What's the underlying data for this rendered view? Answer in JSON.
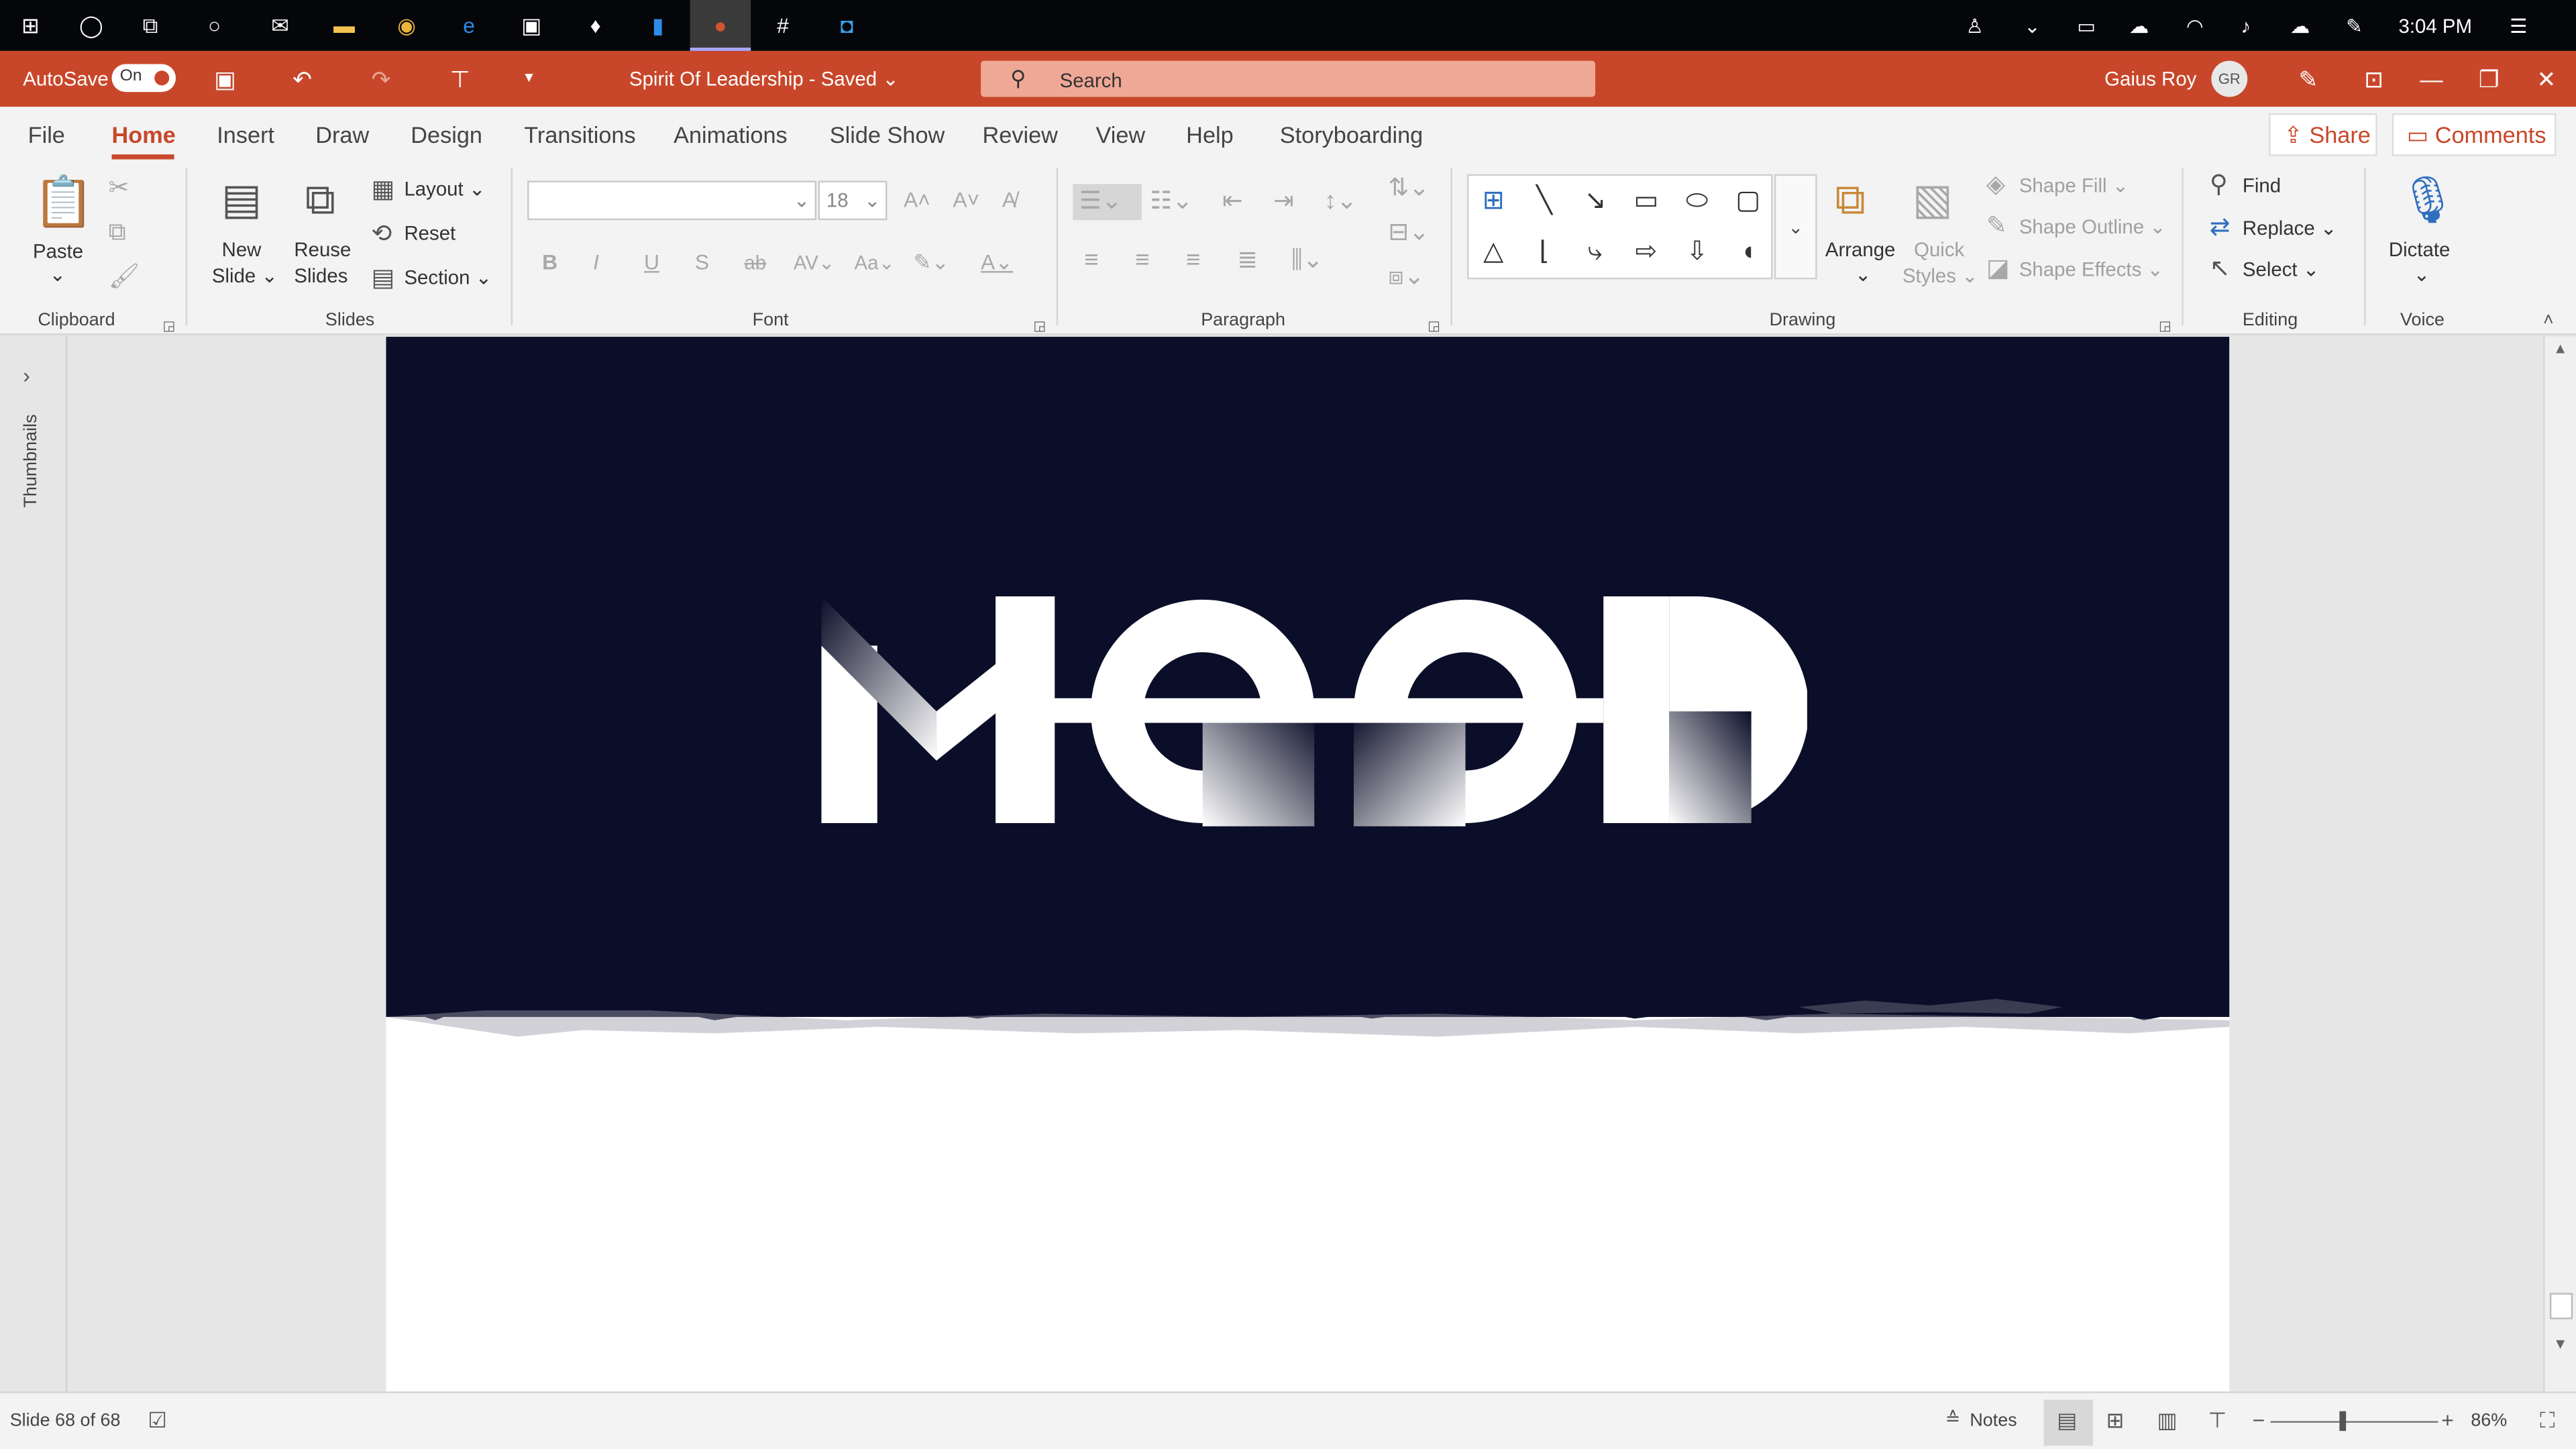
{
  "taskbar": {
    "apps": [
      {
        "icon": "windows-start-icon",
        "glyph": "⊞"
      },
      {
        "icon": "cortana-icon",
        "glyph": "◯"
      },
      {
        "icon": "task-view-icon",
        "glyph": "⧉"
      },
      {
        "icon": "app-circle-icon",
        "glyph": "○"
      },
      {
        "icon": "mail-icon",
        "glyph": "✉"
      },
      {
        "icon": "file-explorer-icon",
        "glyph": "▬"
      },
      {
        "icon": "chrome-icon",
        "glyph": "◉"
      },
      {
        "icon": "edge-icon",
        "glyph": "e"
      },
      {
        "icon": "store-icon",
        "glyph": "▣"
      },
      {
        "icon": "lightbulb-icon",
        "glyph": "♦"
      },
      {
        "icon": "phone-icon",
        "glyph": "▮"
      },
      {
        "icon": "powerpoint-icon",
        "glyph": "●"
      },
      {
        "icon": "slack-icon",
        "glyph": "#"
      },
      {
        "icon": "app-square-icon",
        "glyph": "◘"
      }
    ],
    "tray": [
      {
        "icon": "people-icon",
        "glyph": "♙"
      },
      {
        "icon": "chevron-up-icon",
        "glyph": "⌄"
      },
      {
        "icon": "battery-icon",
        "glyph": "▭"
      },
      {
        "icon": "onedrive-icon",
        "glyph": "☁"
      },
      {
        "icon": "wifi-icon",
        "glyph": "◠"
      },
      {
        "icon": "volume-icon",
        "glyph": "♪"
      },
      {
        "icon": "upload-icon",
        "glyph": "☁"
      },
      {
        "icon": "pen-icon",
        "glyph": "✎"
      }
    ],
    "clock": "3:04 PM",
    "notification_icon": "notification-icon",
    "notification_glyph": "☰"
  },
  "titlebar": {
    "autosave_label": "AutoSave",
    "autosave_state": "On",
    "doc_title": "Spirit Of Leadership  -  Saved  ⌄",
    "search_placeholder": "Search",
    "user_name": "Gaius Roy",
    "user_initials": "GR"
  },
  "tabs": [
    "File",
    "Home",
    "Insert",
    "Draw",
    "Design",
    "Transitions",
    "Animations",
    "Slide Show",
    "Review",
    "View",
    "Help",
    "Storyboarding"
  ],
  "active_tab": "Home",
  "share_label": "Share",
  "comments_label": "Comments",
  "ribbon": {
    "clipboard": {
      "paste": "Paste",
      "label": "Clipboard"
    },
    "slides": {
      "new_slide_1": "New",
      "new_slide_2": "Slide ⌄",
      "reuse_1": "Reuse",
      "reuse_2": "Slides",
      "layout": "Layout ⌄",
      "reset": "Reset",
      "section": "Section ⌄",
      "label": "Slides"
    },
    "font": {
      "font_name": "",
      "font_size": "18",
      "label": "Font"
    },
    "paragraph": {
      "label": "Paragraph"
    },
    "drawing": {
      "arrange": "Arrange",
      "quick_1": "Quick",
      "quick_2": "Styles ⌄",
      "shape_fill": "Shape Fill ⌄",
      "shape_outline": "Shape Outline ⌄",
      "shape_effects": "Shape Effects ⌄",
      "label": "Drawing"
    },
    "editing": {
      "find": "Find",
      "replace": "Replace ⌄",
      "select": "Select ⌄",
      "label": "Editing"
    },
    "voice": {
      "dictate": "Dictate",
      "label": "Voice"
    }
  },
  "thumbnails_label": "Thumbnails",
  "slide": {
    "logo_text": "MEED",
    "band_color": "#0b0e28"
  },
  "status": {
    "slide_counter": "Slide 68 of 68",
    "notes": "Notes",
    "zoom": "86%"
  },
  "colors": {
    "accent": "#c8472a",
    "search_bg": "#f0a896"
  }
}
